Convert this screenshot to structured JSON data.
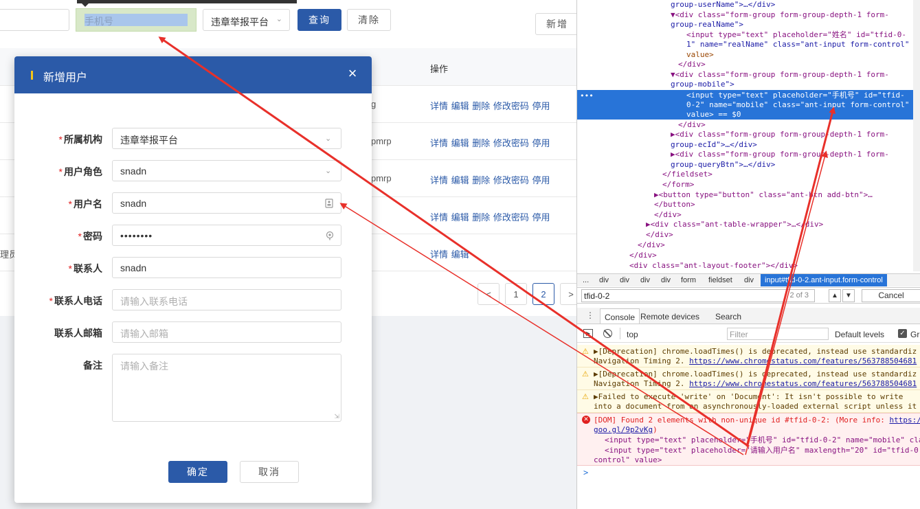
{
  "toolbar": {
    "mobile_placeholder": "手机号",
    "platform_select": "违章举报平台",
    "query_label": "查询",
    "clear_label": "清除",
    "add_label": "新增"
  },
  "table": {
    "col_operation": "操作",
    "rows": [
      {
        "pre": "",
        "frag": "g",
        "actions": "详情 编辑 删除 修改密码 停用"
      },
      {
        "pre": "",
        "frag": "pmrp",
        "actions": "详情 编辑 删除 修改密码 停用"
      },
      {
        "pre": "",
        "frag": "pmrp",
        "actions": "详情 编辑 删除 修改密码 停用"
      },
      {
        "pre": "",
        "frag": "",
        "actions": "详情 编辑 删除 修改密码 停用"
      },
      {
        "pre": "理员",
        "frag": "",
        "actions": "详情 编辑"
      }
    ],
    "pagination": {
      "prev": "<",
      "page1": "1",
      "page2": "2",
      "next": ">"
    }
  },
  "modal": {
    "title": "新增用户",
    "close": "×",
    "required_mark": "*",
    "fields": {
      "org": {
        "label": "所属机构",
        "value": "违章举报平台"
      },
      "role": {
        "label": "用户角色",
        "value": "snadn"
      },
      "username": {
        "label": "用户名",
        "value": "snadn"
      },
      "password": {
        "label": "密码",
        "value": "••••••••"
      },
      "contact": {
        "label": "联系人",
        "value": "snadn"
      },
      "phone": {
        "label": "联系人电话",
        "placeholder": "请输入联系电话"
      },
      "email": {
        "label": "联系人邮箱",
        "placeholder": "请输入邮箱"
      },
      "remark": {
        "label": "备注",
        "placeholder": "请输入备注"
      }
    },
    "confirm_label": "确定",
    "cancel_label": "取消"
  },
  "devtools": {
    "breadcrumb": [
      "...",
      "div",
      "div",
      "div",
      "div",
      "form",
      "fieldset",
      "div",
      "input#tfid-0-2.ant-input.form-control"
    ],
    "search": {
      "value": "tfid-0-2",
      "count": "2 of 3",
      "cancel": "Cancel"
    },
    "tabs": [
      "Console",
      "Remote devices",
      "Search"
    ],
    "context": "top",
    "filter_placeholder": "Filter",
    "levels": "Default levels",
    "group_label": "Gr",
    "messages": [
      {
        "line1": "▶[Deprecation] chrome.loadTimes() is deprecated, instead use standardiz",
        "line2_text": "Navigation Timing 2. ",
        "line2_link": "https://www.chromestatus.com/features/563788504681"
      },
      {
        "line1": "▶[Deprecation] chrome.loadTimes() is deprecated, instead use standardiz",
        "line2_text": "Navigation Timing 2. ",
        "line2_link": "https://www.chromestatus.com/features/563788504681"
      },
      {
        "line1": "▶Failed to execute 'write' on 'Document': It isn't possible to write",
        "line2_text": "into a document from an asynchronously-loaded external script unless it",
        "line2_link": ""
      }
    ],
    "error": {
      "line1_text": "[DOM] Found 2 elements with non-unique id #tfid-0-2: (More info: ",
      "line1_link": "https:/",
      "line2_link": "goo.gl/9p2vKg",
      "line2_tail": ")",
      "line3": "<input type=\"text\" placeholder=\"手机号\" id=\"tfid-0-2\" name=\"mobile\" cla",
      "line4": "<input type=\"text\" placeholder=\"请输入用户名\" maxlength=\"20\" id=\"tfid-0",
      "line5": "control\" value>"
    },
    "prompt": ">",
    "dom_lines": [
      "group-userName\">…</div>",
      "▼<div class=\"form-group form-group-depth-1 form-",
      "group-realName\">",
      "<input type=\"text\" placeholder=\"姓名\" id=\"tfid-0-",
      "1\" name=\"realName\" class=\"ant-input form-control\"",
      "value>",
      "</div>",
      "▼<div class=\"form-group form-group-depth-1 form-",
      "group-mobile\">",
      "<input type=\"text\" placeholder=\"手机号\" id=\"tfid-",
      "0-2\" name=\"mobile\" class=\"ant-input form-control\"",
      "value> == $0",
      "</div>",
      "▶<div class=\"form-group form-group-depth-1 form-",
      "group-ecId\">…</div>",
      "▶<div class=\"form-group form-group-depth-1 form-",
      "group-queryBtn\">…</div>",
      "</fieldset>",
      "</form>",
      "▶<button type=\"button\" class=\"ant-btn add-btn\">…",
      "</button>",
      "</div>",
      "▶<div class=\"ant-table-wrapper\">…</div>",
      "</div>",
      "</div>",
      "</div>",
      "<div class=\"ant-layout-footer\"></div>"
    ]
  }
}
